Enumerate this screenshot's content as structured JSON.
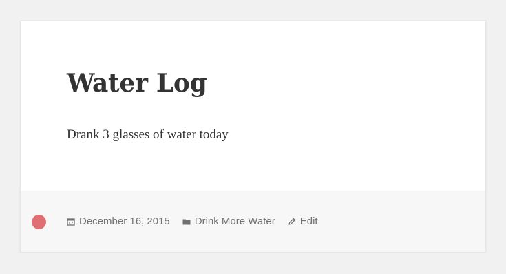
{
  "post": {
    "title": "Water Log",
    "content": "Drank 3 glasses of water today"
  },
  "footer": {
    "date": "December 16, 2015",
    "category": "Drink More Water",
    "edit_label": "Edit"
  },
  "colors": {
    "format_dot": "#e16e72",
    "meta_text": "#707070",
    "title_text": "#333333"
  },
  "icons": {
    "date": "calendar-icon",
    "category": "folder-icon",
    "edit": "pencil-icon",
    "format": "status-dot-icon"
  }
}
